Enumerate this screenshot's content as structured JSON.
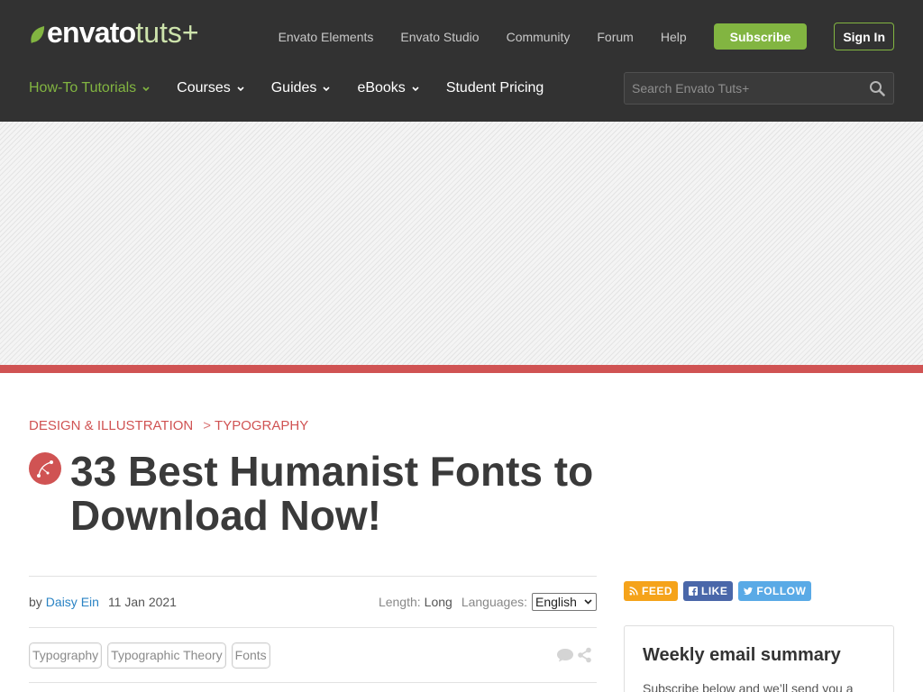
{
  "colors": {
    "header_bg": "#323232",
    "accent_green": "#82b541",
    "category_red": "#d05353",
    "link_blue": "#2a83c4"
  },
  "header": {
    "logo": {
      "brand": "envato",
      "product": "tuts+",
      "icon": "leaf-icon"
    },
    "top_nav": [
      "Envato Elements",
      "Envato Studio",
      "Community",
      "Forum",
      "Help"
    ],
    "subscribe_label": "Subscribe",
    "sign_in_label": "Sign In",
    "main_nav": [
      {
        "label": "How-To Tutorials",
        "dropdown": true,
        "active": true
      },
      {
        "label": "Courses",
        "dropdown": true,
        "active": false
      },
      {
        "label": "Guides",
        "dropdown": true,
        "active": false
      },
      {
        "label": "eBooks",
        "dropdown": true,
        "active": false
      },
      {
        "label": "Student Pricing",
        "dropdown": false,
        "active": false
      }
    ],
    "search": {
      "placeholder": "Search Envato Tuts+",
      "icon": "search-icon"
    }
  },
  "breadcrumb": {
    "items": [
      "DESIGN & ILLUSTRATION",
      "TYPOGRAPHY"
    ],
    "separator": ">"
  },
  "article": {
    "category_icon": "bezier-curve-icon",
    "title": "33 Best Humanist Fonts to Download Now!",
    "meta": {
      "by_label": "by",
      "author": "Daisy Ein",
      "date": "11 Jan 2021",
      "length_label": "Length:",
      "length_value": "Long",
      "languages_label": "Languages:",
      "language_selected": "English"
    },
    "tags": [
      "Typography",
      "Typographic Theory",
      "Fonts"
    ],
    "action_icons": [
      "comment-icon",
      "share-icon"
    ]
  },
  "sidebar": {
    "social": [
      {
        "label": "FEED",
        "icon": "rss-icon",
        "color": "#f5a31a"
      },
      {
        "label": "LIKE",
        "icon": "facebook-icon",
        "color": "#4a67a9"
      },
      {
        "label": "FOLLOW",
        "icon": "twitter-icon",
        "color": "#5aaae6"
      }
    ],
    "newsletter": {
      "title": "Weekly email summary",
      "text": "Subscribe below and we’ll send you a"
    }
  }
}
